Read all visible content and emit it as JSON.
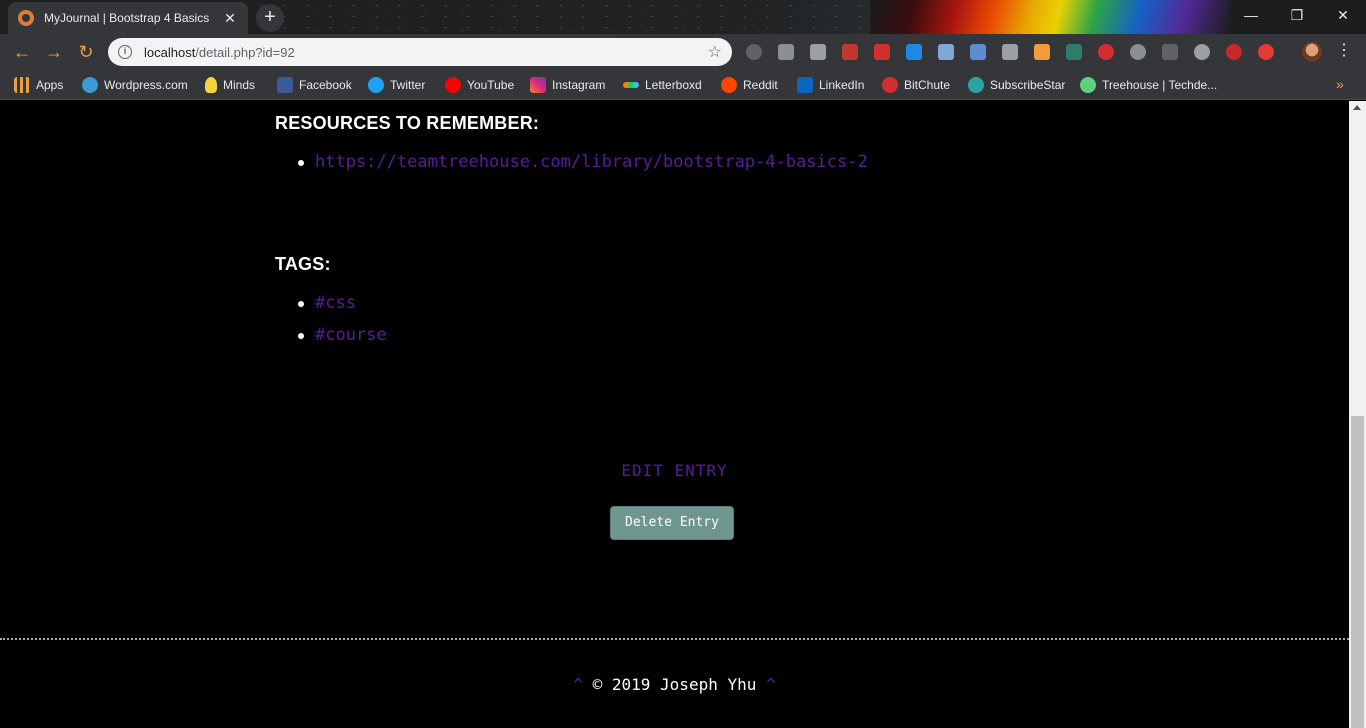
{
  "browser": {
    "tab_title": "MyJournal | Bootstrap 4 Basics",
    "tab_close": "✕",
    "new_tab": "+",
    "url_host": "localhost",
    "url_path": "/detail.php?id=92",
    "window_controls": {
      "minimize": "—",
      "restore": "❐",
      "close": "✕"
    }
  },
  "bookmarks": [
    {
      "label": "Apps",
      "icon": "apps-grid-icon"
    },
    {
      "label": "Wordpress.com",
      "icon": "wordpress-icon"
    },
    {
      "label": "Minds",
      "icon": "minds-lightbulb-icon"
    },
    {
      "label": "Facebook",
      "icon": "facebook-icon"
    },
    {
      "label": "Twitter",
      "icon": "twitter-icon"
    },
    {
      "label": "YouTube",
      "icon": "youtube-icon"
    },
    {
      "label": "Instagram",
      "icon": "instagram-icon"
    },
    {
      "label": "Letterboxd",
      "icon": "letterboxd-icon"
    },
    {
      "label": "Reddit",
      "icon": "reddit-icon"
    },
    {
      "label": "LinkedIn",
      "icon": "linkedin-icon"
    },
    {
      "label": "BitChute",
      "icon": "bitchute-icon"
    },
    {
      "label": "SubscribeStar",
      "icon": "subscribestar-icon"
    },
    {
      "label": "Treehouse | Techde...",
      "icon": "treehouse-icon"
    }
  ],
  "page": {
    "resources_heading": "RESOURCES TO REMEMBER:",
    "resources": [
      "https://teamtreehouse.com/library/bootstrap-4-basics-2"
    ],
    "tags_heading": "TAGS:",
    "tags": [
      "#css",
      "#course"
    ],
    "edit_label": "EDIT ENTRY",
    "delete_label": "Delete Entry",
    "footer_text": "© 2019 Joseph Yhu",
    "footer_caret": "^"
  },
  "colors": {
    "link": "#5a1aa0",
    "delete_button": "#6e958e",
    "background": "#000000"
  }
}
